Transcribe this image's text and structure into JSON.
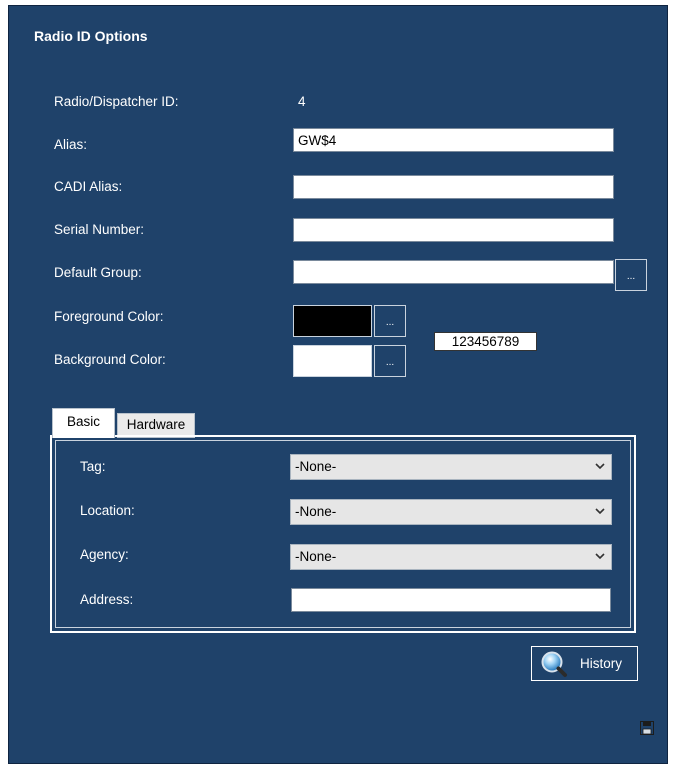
{
  "title": "Radio ID Options",
  "fields": {
    "radio_id_label": "Radio/Dispatcher ID:",
    "radio_id_value": "4",
    "alias_label": "Alias:",
    "alias_value": "GW$4",
    "cadi_alias_label": "CADI Alias:",
    "cadi_alias_value": "",
    "serial_label": "Serial Number:",
    "serial_value": "",
    "default_group_label": "Default Group:",
    "default_group_value": "",
    "fg_color_label": "Foreground Color:",
    "bg_color_label": "Background Color:",
    "browse_label": "...",
    "preview_text": "123456789"
  },
  "colors": {
    "foreground": "#000000",
    "background": "#ffffff",
    "panel": "#1f426a"
  },
  "tabs": [
    {
      "label": "Basic",
      "active": true
    },
    {
      "label": "Hardware",
      "active": false
    }
  ],
  "basic": {
    "tag_label": "Tag:",
    "tag_value": "-None-",
    "location_label": "Location:",
    "location_value": "-None-",
    "agency_label": "Agency:",
    "agency_value": "-None-",
    "address_label": "Address:",
    "address_value": ""
  },
  "history_label": "History",
  "icons": {
    "history": "magnifier-icon",
    "save": "save-icon",
    "dropdown": "chevron-down-icon"
  }
}
